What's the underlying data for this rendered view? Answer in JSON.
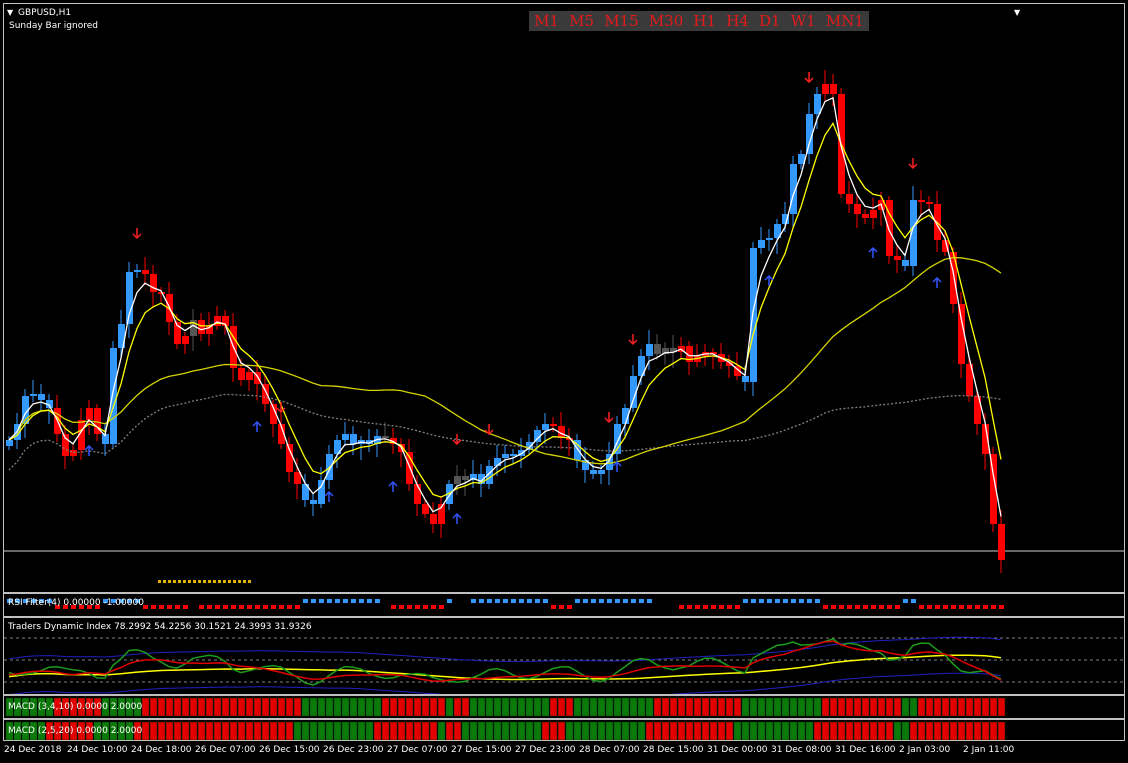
{
  "main": {
    "symbol_label": "GBPUSD,H1",
    "note": "Sunday Bar ignored",
    "timeframes": [
      "M1",
      "M5",
      "M15",
      "M30",
      "H1",
      "H4",
      "D1",
      "W1",
      "MN1"
    ],
    "bull_color": "#3399ff",
    "bear_color": "#ff0000",
    "neutral_color": "#555555",
    "fast_ma_color": "#ffffff",
    "slow_ma_color": "#ffff00",
    "long_ma_color": "#d4d400"
  },
  "rsi_filter": {
    "label": "RSI Filter(4) 0.00000 -1.00000"
  },
  "tdi": {
    "label": "Traders Dynamic Index 78.2992 54.2256 30.1521 24.3993 31.9326"
  },
  "macd1": {
    "label": "MACD (3,4,10) 0.0000 2.0000"
  },
  "macd2": {
    "label": "MACD (2,5,20) 0.0000 2.0000"
  },
  "time_axis": {
    "ticks": [
      "24 Dec 2018",
      "24 Dec 10:00",
      "24 Dec 18:00",
      "26 Dec 07:00",
      "26 Dec 15:00",
      "26 Dec 23:00",
      "27 Dec 07:00",
      "27 Dec 15:00",
      "27 Dec 23:00",
      "28 Dec 07:00",
      "28 Dec 15:00",
      "31 Dec 00:00",
      "31 Dec 08:00",
      "31 Dec 16:00",
      "2 Jan 03:00",
      "2 Jan 11:00"
    ]
  },
  "chart_data": {
    "type": "candlestick",
    "symbol": "GBPUSD",
    "timeframe": "H1",
    "closes": [
      436,
      420,
      392,
      390,
      396,
      404,
      430,
      452,
      446,
      416,
      404,
      430,
      440,
      344,
      320,
      268,
      266,
      270,
      288,
      290,
      318,
      340,
      332,
      316,
      330,
      322,
      312,
      322,
      364,
      376,
      368,
      380,
      400,
      420,
      440,
      468,
      480,
      496,
      500,
      476,
      450,
      436,
      430,
      440,
      436,
      440,
      432,
      434,
      440,
      448,
      480,
      500,
      510,
      520,
      500,
      480,
      472,
      476,
      470,
      480,
      462,
      454,
      450,
      452,
      446,
      438,
      426,
      420,
      422,
      434,
      436,
      456,
      466,
      470,
      466,
      450,
      420,
      404,
      372,
      352,
      340,
      350,
      344,
      348,
      342,
      358,
      352,
      348,
      350,
      358,
      362,
      372,
      378,
      244,
      236,
      234,
      220,
      210,
      160,
      150,
      110,
      90,
      80,
      90,
      190,
      200,
      210,
      214,
      206,
      196,
      252,
      256,
      262,
      196,
      198,
      200,
      236,
      248,
      300,
      360,
      392,
      420,
      450,
      520,
      556
    ],
    "trend": [
      "b",
      "b",
      "b",
      "b",
      "b",
      "b",
      "r",
      "r",
      "r",
      "r",
      "r",
      "r",
      "b",
      "b",
      "b",
      "b",
      "b",
      "r",
      "r",
      "r",
      "r",
      "r",
      "r",
      "n",
      "r",
      "r",
      "r",
      "r",
      "r",
      "r",
      "r",
      "r",
      "r",
      "r",
      "r",
      "r",
      "r",
      "b",
      "b",
      "b",
      "b",
      "b",
      "b",
      "b",
      "b",
      "b",
      "b",
      "n",
      "r",
      "r",
      "r",
      "r",
      "r",
      "r",
      "r",
      "b",
      "n",
      "n",
      "b",
      "b",
      "b",
      "b",
      "b",
      "b",
      "b",
      "b",
      "b",
      "b",
      "r",
      "r",
      "r",
      "b",
      "b",
      "b",
      "b",
      "b",
      "b",
      "b",
      "b",
      "b",
      "b",
      "n",
      "n",
      "n",
      "r",
      "r",
      "r",
      "r",
      "r",
      "r",
      "r",
      "r",
      "b",
      "b",
      "b",
      "b",
      "b",
      "b",
      "b",
      "b",
      "b",
      "b",
      "r",
      "r",
      "r",
      "r",
      "r",
      "r",
      "r",
      "r",
      "r",
      "r",
      "b",
      "b",
      "r",
      "r",
      "r",
      "r",
      "r",
      "r",
      "r",
      "r",
      "r",
      "r",
      "r",
      "r",
      "r"
    ]
  }
}
